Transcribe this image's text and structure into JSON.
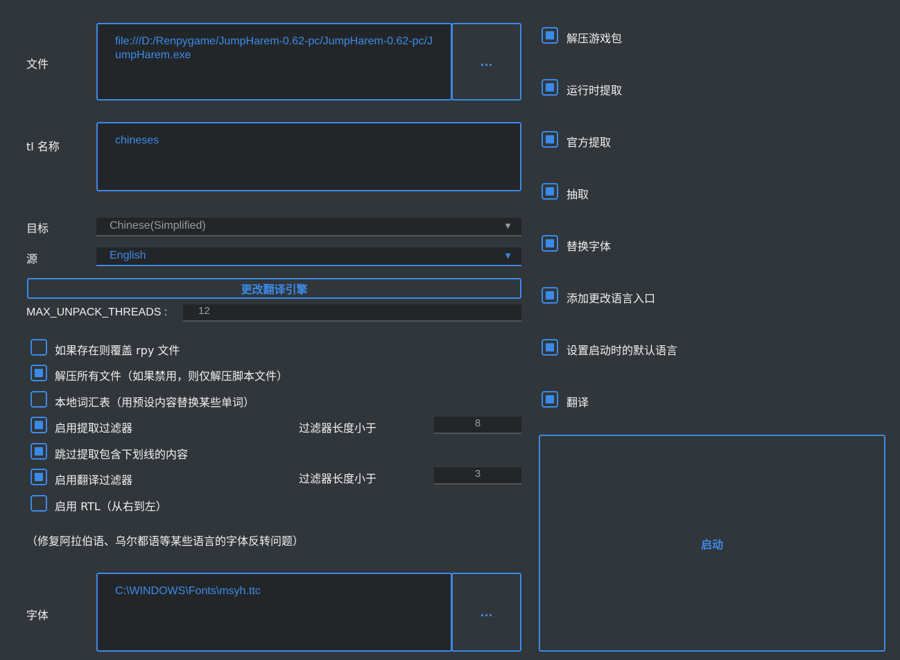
{
  "file": {
    "label": "文件",
    "path": "file:///D:/Renpygame/JumpHarem-0.62-pc/JumpHarem-0.62-pc/JumpHarem.exe",
    "browse_label": "..."
  },
  "tl_name": {
    "label": "tl 名称",
    "value": "chineses"
  },
  "target": {
    "label": "目标",
    "value": "Chinese(Simplified)"
  },
  "source": {
    "label": "源",
    "value": "English"
  },
  "change_engine_label": "更改翻译引擎",
  "threads": {
    "label": "MAX_UNPACK_THREADS :",
    "value": "12"
  },
  "options": [
    {
      "label": "如果存在则覆盖 rpy 文件",
      "checked": false
    },
    {
      "label": "解压所有文件（如果禁用，则仅解压脚本文件）",
      "checked": true
    },
    {
      "label": "本地词汇表（用预设内容替换某些单词）",
      "checked": false
    },
    {
      "label": "启用提取过滤器",
      "checked": true
    },
    {
      "label": "跳过提取包含下划线的内容",
      "checked": true
    },
    {
      "label": "启用翻译过滤器",
      "checked": true
    },
    {
      "label": "启用 RTL（从右到左）",
      "checked": false
    }
  ],
  "extract_filter": {
    "label": "过滤器长度小于",
    "value": "8"
  },
  "translate_filter": {
    "label": "过滤器长度小于",
    "value": "3"
  },
  "rtl_note": "（修复阿拉伯语、乌尔都语等某些语言的字体反转问题）",
  "font": {
    "label": "字体",
    "path": "C:\\WINDOWS\\Fonts\\msyh.ttc",
    "browse_label": "..."
  },
  "steps": [
    {
      "label": "解压游戏包",
      "checked": true
    },
    {
      "label": "运行时提取",
      "checked": true
    },
    {
      "label": "官方提取",
      "checked": true
    },
    {
      "label": "抽取",
      "checked": true
    },
    {
      "label": "替换字体",
      "checked": true
    },
    {
      "label": "添加更改语言入口",
      "checked": true
    },
    {
      "label": "设置启动时的默认语言",
      "checked": true
    },
    {
      "label": "翻译",
      "checked": true
    }
  ],
  "start_label": "启动",
  "colors": {
    "accent": "#3c8ae8",
    "background": "#31363b",
    "field": "#232629"
  }
}
